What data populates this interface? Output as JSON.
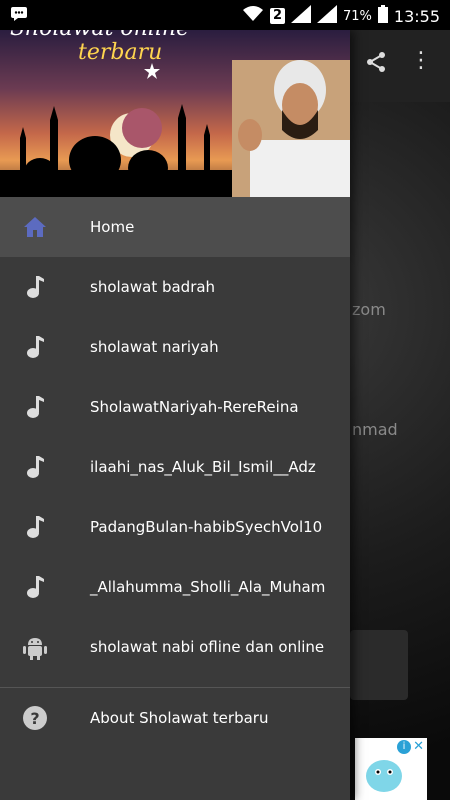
{
  "status_bar": {
    "sim": "2",
    "battery": "71%",
    "time": "13:55"
  },
  "header": {
    "title_line1": "Sholawat online",
    "title_line2": "terbaru"
  },
  "menu": {
    "items": [
      {
        "label": "Home",
        "icon": "home-icon",
        "active": true
      },
      {
        "label": "sholawat badrah",
        "icon": "music-note-icon"
      },
      {
        "label": "sholawat nariyah",
        "icon": "music-note-icon"
      },
      {
        "label": "SholawatNariyah-RereReina",
        "icon": "music-note-icon"
      },
      {
        "label": "ilaahi_nas_Aluk_Bil_Ismil__Adz",
        "icon": "music-note-icon"
      },
      {
        "label": "PadangBulan-habibSyechVol10",
        "icon": "music-note-icon"
      },
      {
        "label": "_Allahumma_Sholli_Ala_Muham",
        "icon": "music-note-icon"
      },
      {
        "label": "sholawat nabi ofline dan online",
        "icon": "android-icon"
      }
    ],
    "about_label": "About Sholawat terbaru"
  },
  "background": {
    "partial_text_1": "zom",
    "partial_text_2": "nmad"
  },
  "colors": {
    "drawer_bg": "#3a3a3a",
    "active_item_bg": "#4d4d4d",
    "home_icon": "#5c6bc0",
    "status_bar_bg": "#000000"
  }
}
